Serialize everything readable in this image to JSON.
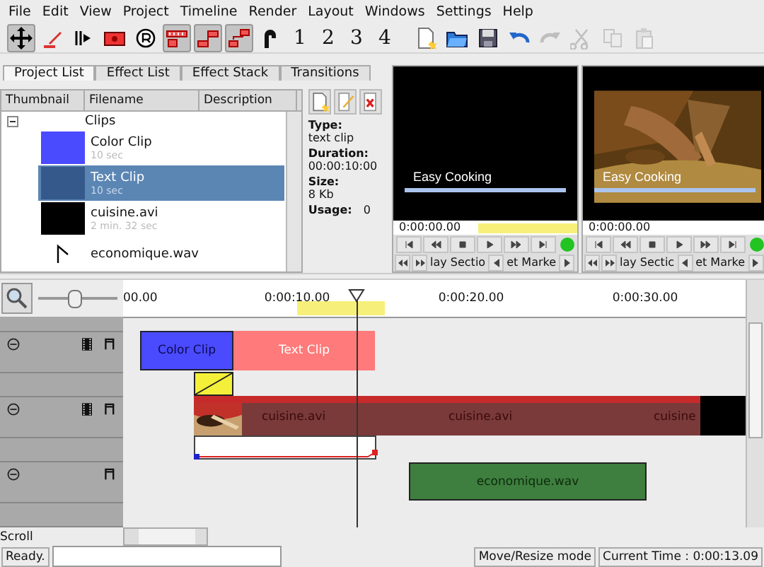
{
  "menu": [
    "File",
    "Edit",
    "View",
    "Project",
    "Timeline",
    "Render",
    "Layout",
    "Windows",
    "Settings",
    "Help"
  ],
  "toolbar": {
    "tools": [
      {
        "kind": "move",
        "selected": true
      },
      {
        "kind": "razor",
        "selected": false
      },
      {
        "kind": "spacer",
        "selected": false
      },
      {
        "kind": "marker",
        "selected": false
      },
      {
        "kind": "render",
        "selected": false
      },
      {
        "kind": "grid",
        "selected": true
      },
      {
        "kind": "snap",
        "selected": true
      },
      {
        "kind": "magnet",
        "selected": true
      },
      {
        "kind": "hook",
        "selected": false
      }
    ],
    "track_buttons": [
      "1",
      "2",
      "3",
      "4"
    ],
    "file_actions": [
      {
        "kind": "new",
        "disabled": false
      },
      {
        "kind": "open",
        "disabled": false
      },
      {
        "kind": "save",
        "disabled": false
      },
      {
        "kind": "undo",
        "disabled": false
      },
      {
        "kind": "redo",
        "disabled": true
      },
      {
        "kind": "cut",
        "disabled": true
      },
      {
        "kind": "copy",
        "disabled": true
      },
      {
        "kind": "paste",
        "disabled": true
      }
    ]
  },
  "project_panel": {
    "tabs": [
      {
        "label": "Project List",
        "selected": true
      },
      {
        "label": "Effect List",
        "selected": false
      },
      {
        "label": "Effect Stack",
        "selected": false
      },
      {
        "label": "Transitions",
        "selected": false
      }
    ],
    "columns": [
      "Thumbnail",
      "Filename",
      "Description"
    ],
    "folder": {
      "name": "Clips",
      "expanded": true
    },
    "clips": [
      {
        "kind": "color",
        "name": "Color Clip",
        "duration": "10 sec",
        "selected": false
      },
      {
        "kind": "text",
        "name": "Text Clip",
        "duration": "10 sec",
        "selected": true
      },
      {
        "kind": "video",
        "name": "cuisine.avi",
        "duration": "2 min. 32 sec",
        "selected": false
      },
      {
        "kind": "audio",
        "name": "economique.wav",
        "selected": false
      }
    ],
    "info": [
      {
        "label": "Type:",
        "value": "text clip"
      },
      {
        "label": "Duration:",
        "value": "00:00:10:00"
      },
      {
        "label": "Size:",
        "value": "8 Kb"
      },
      {
        "label": "Usage:",
        "value": "0"
      }
    ]
  },
  "monitors": [
    {
      "kind": "black",
      "caption": "Easy Cooking",
      "timecode": "0:00:00.00",
      "zone": true,
      "buttons": [
        "lay Sectio",
        "et Marke"
      ]
    },
    {
      "kind": "picture",
      "caption": "Easy Cooking",
      "timecode": "0:00:00.00",
      "zone": false,
      "buttons": [
        "lay Sectic",
        "et Marke"
      ]
    }
  ],
  "timeline": {
    "zoom": {
      "level": 0.45
    },
    "ruler": [
      "00.00",
      "0:00:10.00",
      "0:00:20.00",
      "0:00:30.00"
    ],
    "tracks": [
      {
        "kind": "video"
      },
      {
        "kind": "transition"
      },
      {
        "kind": "video"
      },
      {
        "kind": "transition"
      },
      {
        "kind": "audio"
      },
      {
        "kind": "transition"
      }
    ],
    "clips": [
      {
        "kind": "color",
        "label": "Color Clip"
      },
      {
        "kind": "text",
        "label": "Text Clip"
      },
      {
        "kind": "transition"
      },
      {
        "kind": "video",
        "labels": [
          "cuisine.avi",
          "cuisine.avi",
          "cuisine"
        ]
      },
      {
        "kind": "transition-line"
      },
      {
        "kind": "audio",
        "label": "economique.wav"
      }
    ]
  },
  "scroll_label": "Scroll",
  "status_bar": {
    "message": "Ready.",
    "mode": "Move/Resize mode",
    "time": "Current Time : 0:00:13.09"
  }
}
